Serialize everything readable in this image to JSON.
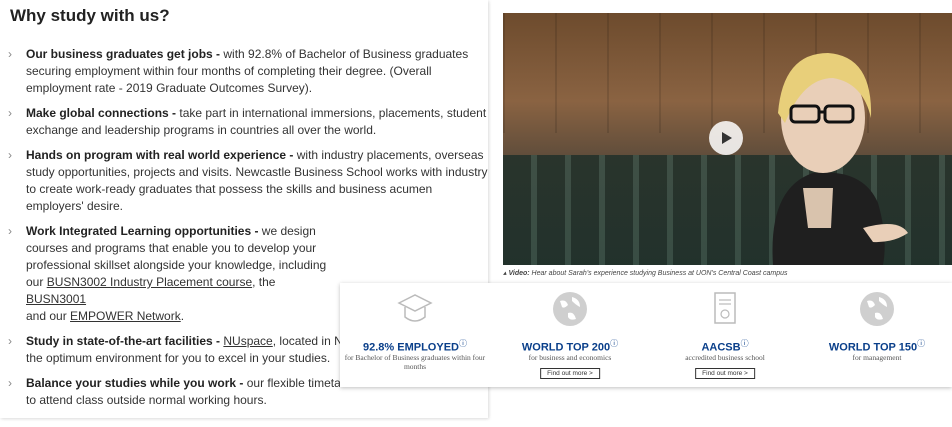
{
  "section_title": "Why study with us?",
  "items": [
    {
      "heading": "Our business graduates get jobs -",
      "text": " with 92.8% of Bachelor of Business graduates securing employment within four months of completing their degree. (Overall employment rate - 2019 Graduate Outcomes Survey)."
    },
    {
      "heading": "Make global connections -",
      "text": " take part in international immersions, placements, student exchange and leadership programs in countries all over the world."
    },
    {
      "heading": "Hands on program with real world experience -",
      "text": " with industry placements, overseas study opportunities, projects and visits. Newcastle Business School works with industry to create work-ready graduates that possess the skills and business acumen employers' desire."
    },
    {
      "heading": "Work Integrated Learning opportunities -",
      "text1": " we design courses and programs that enable you to develop your professional skillset alongside your knowledge, including our ",
      "link1": "BUSN3002 Industry Placement course",
      "text2": ", the ",
      "link2": "BUSN3001",
      "text3": " and our ",
      "link3": "EMPOWER Network",
      "text4": "."
    },
    {
      "heading": "Study in state-of-the-art facilities -",
      "text1": " ",
      "link1": "NUspace",
      "text2": ", located in N",
      "text3": "the optimum environment for you to excel in your studies."
    },
    {
      "heading": "Balance your studies while you work -",
      "text1": " our flexible timeta",
      "text2": "to attend class outside normal working hours."
    }
  ],
  "video": {
    "caption_label": "Video:",
    "caption_text": " Hear about Sarah's experience studying Business at UON's Central Coast campus"
  },
  "stats": [
    {
      "icon": "graduation-cap-icon",
      "headline": "92.8% EMPLOYED",
      "sub": "for Bachelor of Business graduates within four months",
      "button": ""
    },
    {
      "icon": "globe-icon",
      "headline": "WORLD TOP 200",
      "sub": "for business and economics",
      "button": "Find out more  >"
    },
    {
      "icon": "certificate-icon",
      "headline": "AACSB",
      "sub": "accredited business school",
      "button": "Find out more  >"
    },
    {
      "icon": "globe-icon",
      "headline": "WORLD TOP 150",
      "sub": "for management",
      "button": ""
    }
  ],
  "colors": {
    "stat_blue": "#0a3f8a"
  }
}
